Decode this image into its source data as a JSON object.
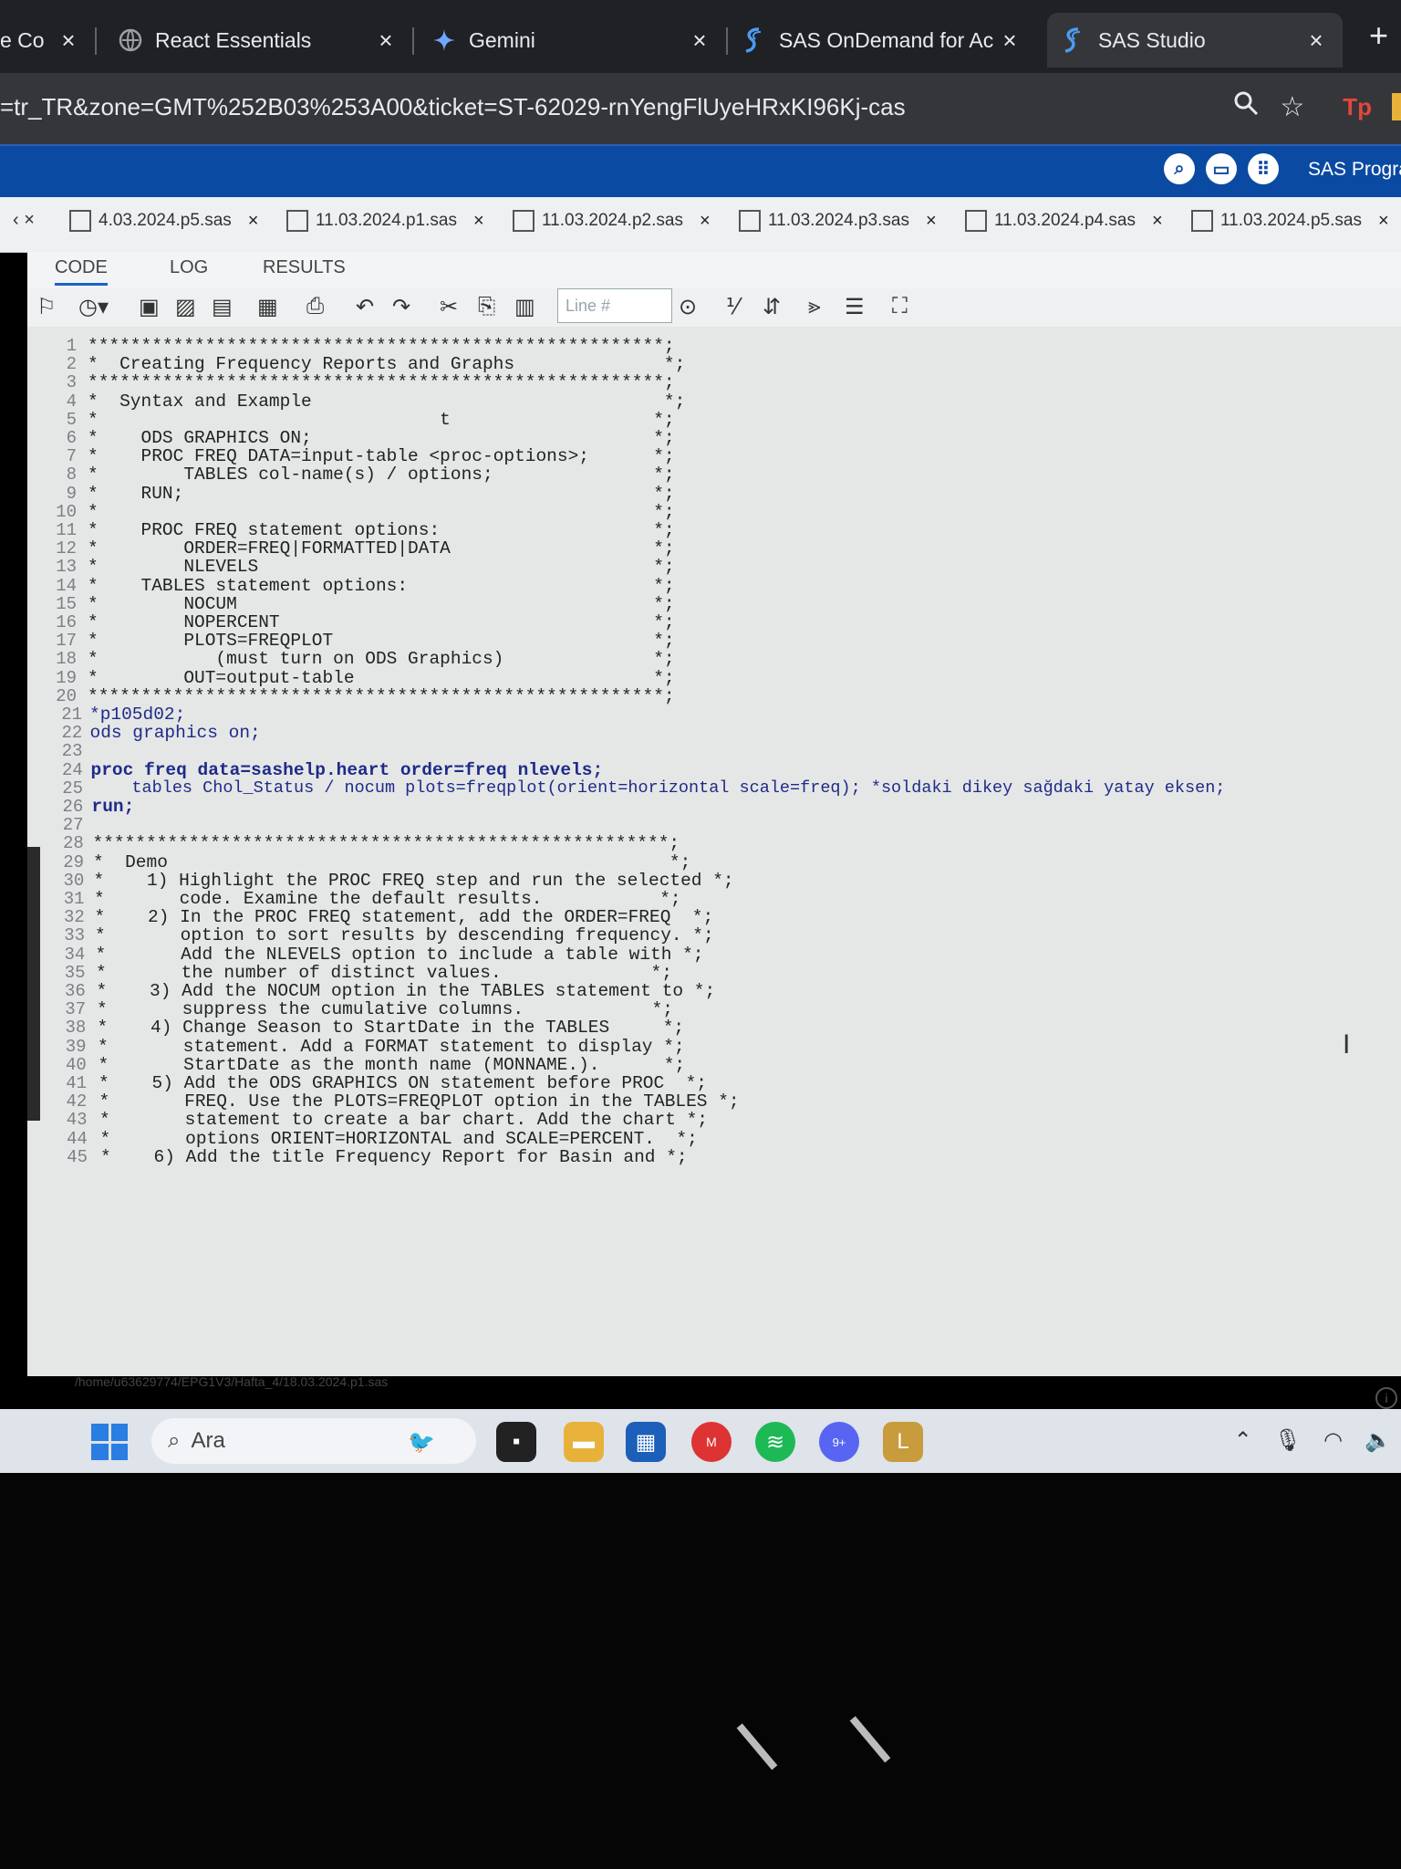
{
  "browser": {
    "tabs": [
      {
        "title": "e Co",
        "close": "×"
      },
      {
        "title": "React Essentials",
        "close": "×"
      },
      {
        "title": "Gemini",
        "close": "×"
      },
      {
        "title": "SAS OnDemand for Ac",
        "close": "×"
      },
      {
        "title": "SAS Studio",
        "close": "×"
      }
    ],
    "new_tab": "+",
    "url": "=tr_TR&zone=GMT%252B03%253A00&ticket=ST-62029-rnYengFlUyeHRxKI96Kj-cas",
    "profile_badge": "Tp"
  },
  "sas_header": {
    "title": "SAS Progra"
  },
  "file_tabs": [
    {
      "label": "4.03.2024.p5.sas"
    },
    {
      "label": "11.03.2024.p1.sas"
    },
    {
      "label": "11.03.2024.p2.sas"
    },
    {
      "label": "11.03.2024.p3.sas"
    },
    {
      "label": "11.03.2024.p4.sas"
    },
    {
      "label": "11.03.2024.p5.sas"
    }
  ],
  "sub_tabs": {
    "code": "CODE",
    "log": "LOG",
    "results": "RESULTS"
  },
  "toolbar": {
    "line_placeholder": "Line #"
  },
  "editor": {
    "lines": [
      {
        "n": "1",
        "text": "******************************************************;"
      },
      {
        "n": "2",
        "text": "*  Creating Frequency Reports and Graphs              *;"
      },
      {
        "n": "3",
        "text": "******************************************************;"
      },
      {
        "n": "4",
        "text": "*  Syntax and Example                                 *;"
      },
      {
        "n": "5",
        "text": "*                                t                   *;"
      },
      {
        "n": "6",
        "text": "*    ODS GRAPHICS ON;                                *;"
      },
      {
        "n": "7",
        "text": "*    PROC FREQ DATA=input-table <proc-options>;      *;"
      },
      {
        "n": "8",
        "text": "*        TABLES col-name(s) / options;               *;"
      },
      {
        "n": "9",
        "text": "*    RUN;                                            *;"
      },
      {
        "n": "10",
        "text": "*                                                    *;"
      },
      {
        "n": "11",
        "text": "*    PROC FREQ statement options:                    *;"
      },
      {
        "n": "12",
        "text": "*        ORDER=FREQ|FORMATTED|DATA                   *;"
      },
      {
        "n": "13",
        "text": "*        NLEVELS                                     *;"
      },
      {
        "n": "14",
        "text": "*    TABLES statement options:                       *;"
      },
      {
        "n": "15",
        "text": "*        NOCUM                                       *;"
      },
      {
        "n": "16",
        "text": "*        NOPERCENT                                   *;"
      },
      {
        "n": "17",
        "text": "*        PLOTS=FREQPLOT                              *;"
      },
      {
        "n": "18",
        "text": "*           (must turn on ODS Graphics)              *;"
      },
      {
        "n": "19",
        "text": "*        OUT=output-table                            *;"
      },
      {
        "n": "20",
        "text": "******************************************************;"
      },
      {
        "n": "21",
        "text": "*p105d02;"
      },
      {
        "n": "22",
        "text": "ods graphics on;"
      },
      {
        "n": "23",
        "text": ""
      },
      {
        "n": "24",
        "text": "proc freq data=sashelp.heart order=freq nlevels;"
      },
      {
        "n": "25",
        "text": "    tables Chol_Status / nocum plots=freqplot(orient=horizontal scale=freq); *soldaki dikey sağdaki yatay eksen;"
      },
      {
        "n": "26",
        "text": "run;"
      },
      {
        "n": "27",
        "text": ""
      },
      {
        "n": "28",
        "text": "******************************************************;"
      },
      {
        "n": "29",
        "text": "*  Demo                                               *;"
      },
      {
        "n": "30",
        "text": "*    1) Highlight the PROC FREQ step and run the selected *;"
      },
      {
        "n": "31",
        "text": "*       code. Examine the default results.           *;"
      },
      {
        "n": "32",
        "text": "*    2) In the PROC FREQ statement, add the ORDER=FREQ  *;"
      },
      {
        "n": "33",
        "text": "*       option to sort results by descending frequency. *;"
      },
      {
        "n": "34",
        "text": "*       Add the NLEVELS option to include a table with *;"
      },
      {
        "n": "35",
        "text": "*       the number of distinct values.              *;"
      },
      {
        "n": "36",
        "text": "*    3) Add the NOCUM option in the TABLES statement to *;"
      },
      {
        "n": "37",
        "text": "*       suppress the cumulative columns.            *;"
      },
      {
        "n": "38",
        "text": "*    4) Change Season to StartDate in the TABLES     *;"
      },
      {
        "n": "39",
        "text": "*       statement. Add a FORMAT statement to display *;"
      },
      {
        "n": "40",
        "text": "*       StartDate as the month name (MONNAME.).      *;"
      },
      {
        "n": "41",
        "text": "*    5) Add the ODS GRAPHICS ON statement before PROC  *;"
      },
      {
        "n": "42",
        "text": "*       FREQ. Use the PLOTS=FREQPLOT option in the TABLES *;"
      },
      {
        "n": "43",
        "text": "*       statement to create a bar chart. Add the chart *;"
      },
      {
        "n": "44",
        "text": "*       options ORIENT=HORIZONTAL and SCALE=PERCENT.  *;"
      },
      {
        "n": "45",
        "text": "*    6) Add the title Frequency Report for Basin and *;"
      }
    ],
    "status_path": "/home/u63629774/EPG1V3/Hafta_4/18.03.2024.p1.sas"
  },
  "taskbar": {
    "search_placeholder": "Ara",
    "chrome_badge": "M",
    "discord_badge": "9+"
  },
  "colors": {
    "browser_bg": "#202124",
    "sas_blue": "#0b4aa2",
    "editor_bg": "#e4e7e5",
    "keyword": "#10187a"
  }
}
